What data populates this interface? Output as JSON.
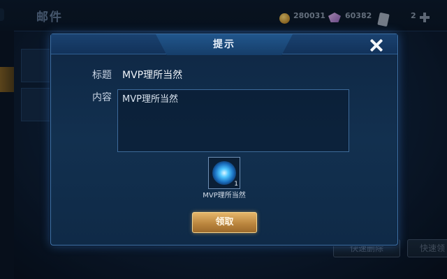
{
  "screen": {
    "title": "邮件"
  },
  "resources": {
    "coins": "280031",
    "gems": "60382",
    "tickets": "2"
  },
  "background_buttons": {
    "quick_delete": "快速删除",
    "quick_claim": "快速领"
  },
  "dialog": {
    "title": "提示",
    "subject_label": "标题",
    "subject_value": "MVP理所当然",
    "content_label": "内容",
    "content_value": "MVP理所当然",
    "attachment": {
      "count": "1",
      "name": "MVP理所当然"
    },
    "claim_button": "领取"
  },
  "colors": {
    "accent_gold": "#c98f45",
    "dialog_border": "#3f72a8"
  }
}
